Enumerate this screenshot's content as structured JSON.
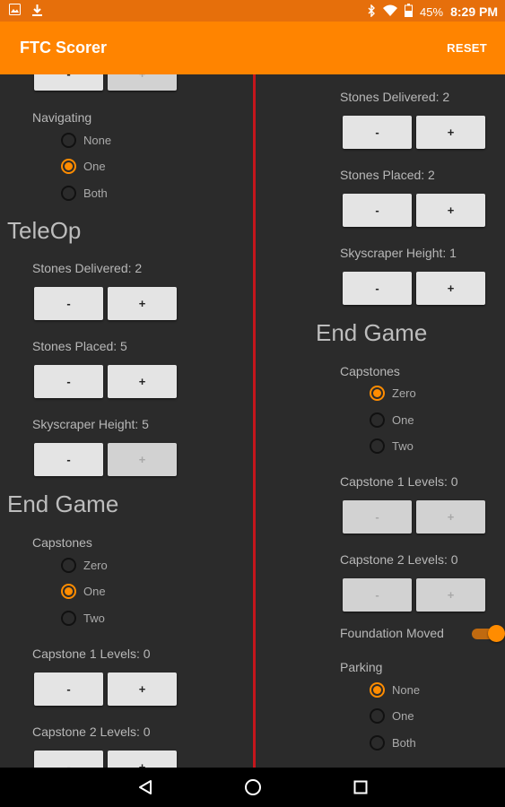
{
  "status_bar": {
    "battery": "45%",
    "time": "8:29 PM"
  },
  "app_bar": {
    "title": "FTC Scorer",
    "reset_label": "RESET"
  },
  "left_column": {
    "top_buttons": {
      "minus": "-",
      "plus": "+"
    },
    "navigating": {
      "label": "Navigating",
      "options": [
        "None",
        "One",
        "Both"
      ],
      "selected": "One"
    },
    "teleop": {
      "header": "TeleOp",
      "stones_delivered": {
        "label": "Stones Delivered: 2",
        "minus": "-",
        "plus": "+"
      },
      "stones_placed": {
        "label": "Stones Placed: 5",
        "minus": "-",
        "plus": "+"
      },
      "skyscraper_height": {
        "label": "Skyscraper Height: 5",
        "minus": "-",
        "plus": "+"
      }
    },
    "end_game": {
      "header": "End Game",
      "capstones": {
        "label": "Capstones",
        "options": [
          "Zero",
          "One",
          "Two"
        ],
        "selected": "One"
      },
      "capstone1_levels": {
        "label": "Capstone 1 Levels: 0",
        "minus": "-",
        "plus": "+"
      },
      "capstone2_levels": {
        "label": "Capstone 2 Levels: 0",
        "minus": "-",
        "plus": "+"
      }
    }
  },
  "right_column": {
    "stones_delivered": {
      "label": "Stones Delivered: 2",
      "minus": "-",
      "plus": "+"
    },
    "stones_placed": {
      "label": "Stones Placed: 2",
      "minus": "-",
      "plus": "+"
    },
    "skyscraper_height": {
      "label": "Skyscraper Height: 1",
      "minus": "-",
      "plus": "+"
    },
    "end_game": {
      "header": "End Game",
      "capstones": {
        "label": "Capstones",
        "options": [
          "Zero",
          "One",
          "Two"
        ],
        "selected": "Zero"
      },
      "capstone1_levels": {
        "label": "Capstone 1 Levels: 0",
        "minus": "-",
        "plus": "+"
      },
      "capstone2_levels": {
        "label": "Capstone 2 Levels: 0",
        "minus": "-",
        "plus": "+"
      },
      "foundation_moved": {
        "label": "Foundation Moved",
        "on": true
      },
      "parking": {
        "label": "Parking",
        "options": [
          "None",
          "One",
          "Both"
        ],
        "selected": "None"
      }
    }
  },
  "colors": {
    "accent": "#ff8400",
    "status_bar": "#e66f0b",
    "divider": "#c4161c",
    "background": "#2b2b2b"
  },
  "nav_icons": [
    "back-icon",
    "home-icon",
    "recents-icon"
  ]
}
